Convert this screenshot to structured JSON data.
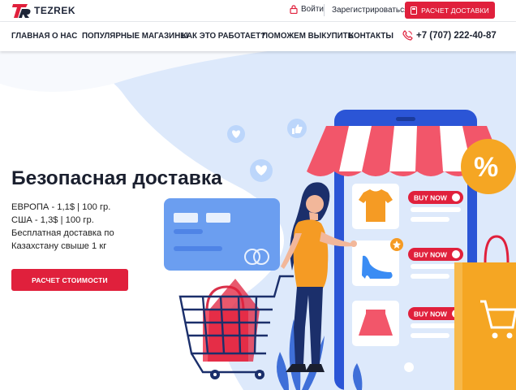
{
  "header": {
    "brand": "TEZREK",
    "login_label": "Войти",
    "register_label": "Зарегистрироваться",
    "delivery_button": "РАСЧЕТ ДОСТАВКИ"
  },
  "nav": {
    "items": [
      "ГЛАВНАЯ",
      "О НАС",
      "ПОПУЛЯРНЫЕ МАГАЗИНЫ",
      "КАК ЭТО РАБОТАЕТ?",
      "ПОМОЖЕМ ВЫКУПИТЬ",
      "КОНТАКТЫ"
    ],
    "phone": "+7 (707) 222-40-87"
  },
  "hero": {
    "title": "Безопасная доставка",
    "lines": [
      "ЕВРОПА - 1,1$ | 100 гр.",
      "США - 1,3$ | 100 гр.",
      "Бесплатная доставка по",
      "Казахстану свыше 1 кг"
    ],
    "calc_button": "РАСЧЕТ СТОИМОСТИ",
    "buy_now_labels": [
      "BUY NOW",
      "BUY NOW",
      "BUY NOW"
    ],
    "percent_badge": "%"
  },
  "colors": {
    "accent": "#e0203c",
    "dark_text": "#1f2533",
    "phone_blue": "#2b55d6",
    "blob_blue": "#dde9fb"
  }
}
